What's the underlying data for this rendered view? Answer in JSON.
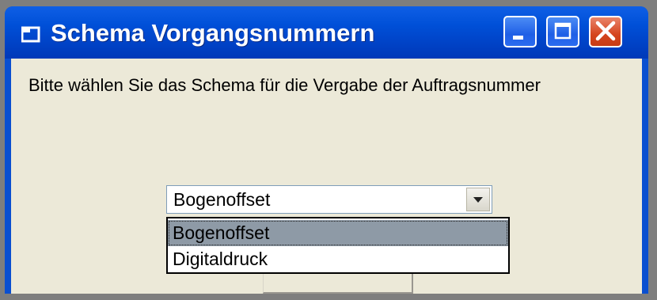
{
  "window": {
    "title": "Schema Vorgangsnummern",
    "titlebar_color": "#0050d8",
    "buttons": [
      "minimize",
      "maximize",
      "close"
    ]
  },
  "content": {
    "prompt": "Bitte wählen Sie das Schema für die Vergabe der Auftragsnummer"
  },
  "combo": {
    "selected_value": "Bogenoffset",
    "options": [
      "Bogenoffset",
      "Digitaldruck"
    ],
    "highlighted_index": 0
  },
  "icons": {
    "title_icon": "window-app-icon",
    "minimize": "minimize-icon",
    "maximize": "maximize-icon",
    "close": "close-icon",
    "dropdown_arrow": "chevron-down-icon"
  }
}
